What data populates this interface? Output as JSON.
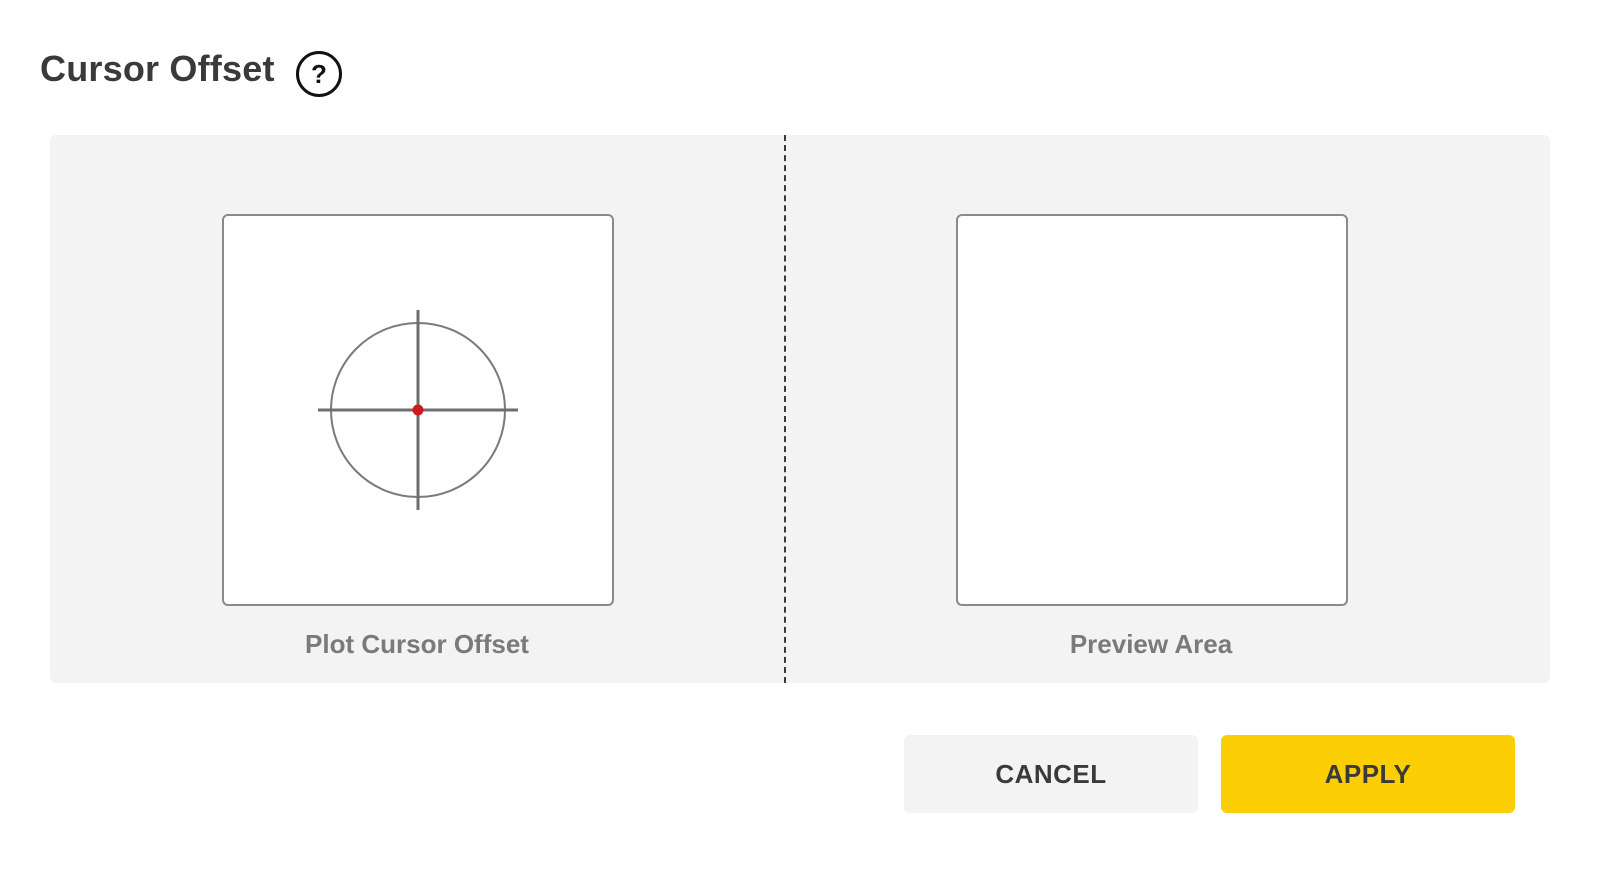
{
  "dialog": {
    "title": "Cursor Offset",
    "help_icon": "question-circle-icon"
  },
  "left_pane": {
    "caption": "Plot Cursor Offset",
    "crosshair_icon": "crosshair-icon",
    "center_marker_color": "#d0181e"
  },
  "right_pane": {
    "caption": "Preview Area"
  },
  "buttons": {
    "cancel_label": "CANCEL",
    "apply_label": "APPLY"
  },
  "colors": {
    "accent": "#fccf04",
    "panel_background": "#f3f3f3",
    "title_text": "#3a3a3a",
    "caption_text": "#7a7a7a"
  }
}
